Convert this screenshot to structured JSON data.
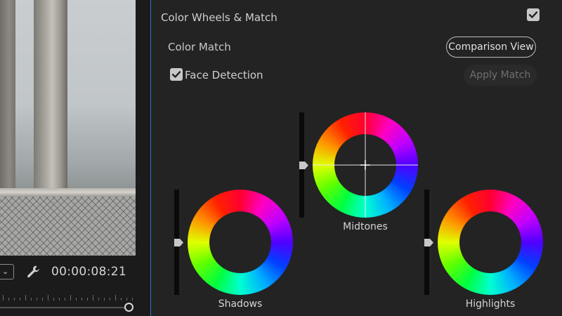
{
  "monitor": {
    "timecode": "00:00:08:21",
    "icons": {
      "zoom_dropdown": "chevron-down-icon",
      "settings": "wrench-icon"
    }
  },
  "panel": {
    "section_title": "Color Wheels & Match",
    "section_enabled": true,
    "color_match_label": "Color Match",
    "comparison_view_label": "Comparison View",
    "face_detection_label": "Face Detection",
    "face_detection_checked": true,
    "apply_match_label": "Apply Match",
    "apply_match_enabled": false
  },
  "wheels": [
    {
      "label": "Midtones"
    },
    {
      "label": "Shadows"
    },
    {
      "label": "Highlights"
    }
  ],
  "colors": {
    "accent_divider": "#2d6fd0",
    "panel_bg": "#232323"
  }
}
